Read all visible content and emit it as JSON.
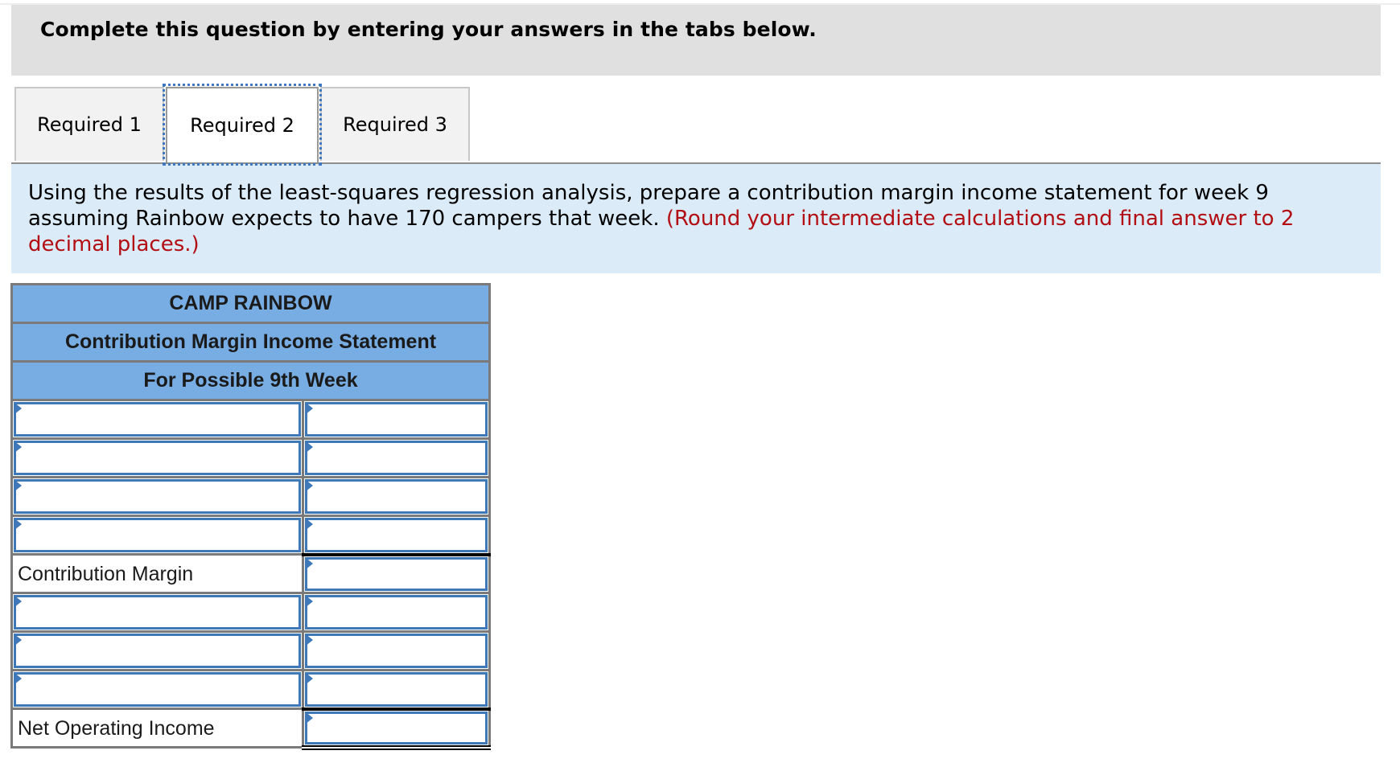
{
  "header": {
    "instruction": "Complete this question by entering your answers in the tabs below."
  },
  "tabs": [
    {
      "label": "Required 1",
      "active": false
    },
    {
      "label": "Required 2",
      "active": true
    },
    {
      "label": "Required 3",
      "active": false
    }
  ],
  "prompt": {
    "text": "Using the results of the least-squares regression analysis, prepare a contribution margin income statement for week 9 assuming Rainbow expects to have 170 campers that week.",
    "note": "(Round your intermediate calculations and final answer to 2 decimal places.)"
  },
  "statement": {
    "company": "CAMP RAINBOW",
    "title": "Contribution Margin Income Statement",
    "period": "For Possible 9th Week",
    "rows": [
      {
        "type": "input",
        "label": "",
        "amount": ""
      },
      {
        "type": "input",
        "label": "",
        "amount": ""
      },
      {
        "type": "input",
        "label": "",
        "amount": ""
      },
      {
        "type": "input",
        "label": "",
        "amount": ""
      },
      {
        "type": "subtotal",
        "label": "Contribution Margin",
        "amount": ""
      },
      {
        "type": "input",
        "label": "",
        "amount": ""
      },
      {
        "type": "input",
        "label": "",
        "amount": ""
      },
      {
        "type": "input",
        "label": "",
        "amount": ""
      },
      {
        "type": "total",
        "label": "Net Operating Income",
        "amount": ""
      }
    ]
  },
  "colors": {
    "header_bar": "#e0e0e0",
    "prompt_bg": "#dbebf8",
    "note_red": "#b20e13",
    "table_header_blue": "#78ade3",
    "input_border_blue": "#3f78b8",
    "focus_outline": "#3f78c0"
  }
}
